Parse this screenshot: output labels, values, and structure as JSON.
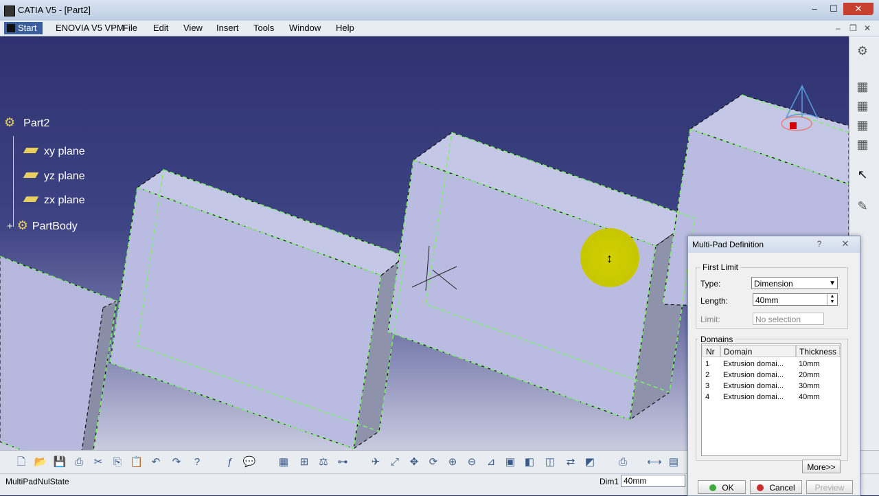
{
  "window": {
    "title": "CATIA V5 - [Part2]",
    "min": "–",
    "max": "☐",
    "close": "✕"
  },
  "menu": {
    "start": "Start",
    "items": [
      "ENOVIA V5 VPM",
      "File",
      "Edit",
      "View",
      "Insert",
      "Tools",
      "Window",
      "Help"
    ],
    "mdi": {
      "min": "–",
      "restore": "❐",
      "close": "✕"
    }
  },
  "tree": {
    "root": "Part2",
    "items": [
      "xy plane",
      "yz plane",
      "zx plane"
    ],
    "body": "PartBody",
    "expander": "+"
  },
  "dialog": {
    "title": "Multi-Pad Definition",
    "help": "?",
    "close": "✕",
    "first_limit": {
      "group": "First Limit",
      "type_label": "Type:",
      "type_value": "Dimension",
      "length_label": "Length:",
      "length_value": "40mm",
      "limit_label": "Limit:",
      "limit_value": "No selection"
    },
    "domains": {
      "group": "Domains",
      "columns": [
        "Nr",
        "Domain",
        "Thickness"
      ],
      "rows": [
        [
          "1",
          "Extrusion domai...",
          "10mm"
        ],
        [
          "2",
          "Extrusion domai...",
          "20mm"
        ],
        [
          "3",
          "Extrusion domai...",
          "30mm"
        ],
        [
          "4",
          "Extrusion domai...",
          "40mm"
        ]
      ]
    },
    "more": "More>>",
    "ok": "OK",
    "cancel": "Cancel",
    "preview": "Preview"
  },
  "status": {
    "message": "MultiPadNulState",
    "dim_label": "Dim1",
    "dim_value": "40mm"
  },
  "colors": {
    "edge": "#7cf26a",
    "face": "#b9bce0",
    "highlight": "#c9c700"
  }
}
